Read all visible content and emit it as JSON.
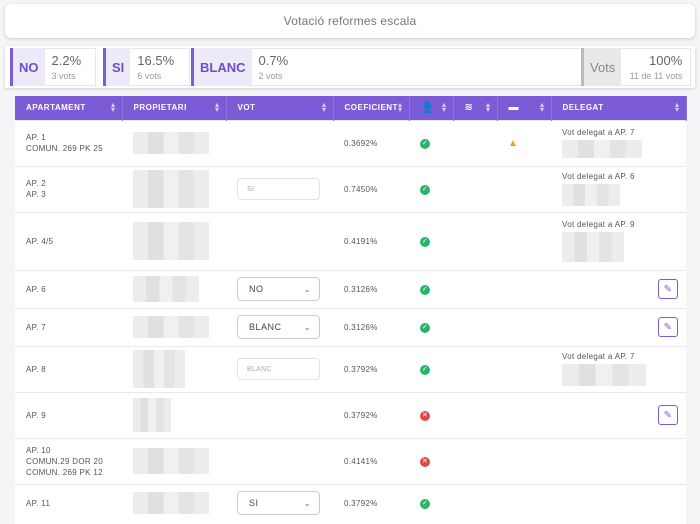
{
  "header": {
    "title": "Votació reformes escala"
  },
  "stats": [
    {
      "label": "NO",
      "pct": "2.2%",
      "count": "3 vots"
    },
    {
      "label": "SI",
      "pct": "16.5%",
      "count": "6 vots"
    },
    {
      "label": "BLANC",
      "pct": "0.7%",
      "count": "2 vots"
    },
    {
      "label": "Vots",
      "pct": "100%",
      "count": "11 de 11 vots"
    }
  ],
  "table": {
    "columns": [
      "APARTAMENT",
      "PROPIETARI",
      "VOT",
      "COEFICIENT",
      "",
      "",
      "",
      "DELEGAT"
    ],
    "rows": [
      {
        "apt": [
          "AP. 1",
          "COMUN. 269 PK 25"
        ],
        "coef": "0.3692%",
        "status": "ok",
        "warn": true,
        "delegat": "Vot delegat a AP. 7"
      },
      {
        "apt": [
          "AP. 2",
          "AP. 3"
        ],
        "vote_static": "SI",
        "coef": "0.7450%",
        "status": "ok",
        "delegat": "Vot delegat a AP. 6"
      },
      {
        "apt": [
          "AP. 4/5"
        ],
        "coef": "0.4191%",
        "status": "ok",
        "delegat": "Vot delegat a AP. 9"
      },
      {
        "apt": [
          "AP. 6"
        ],
        "vote_select": "NO",
        "coef": "0.3126%",
        "status": "ok",
        "edit": true
      },
      {
        "apt": [
          "AP. 7"
        ],
        "vote_select": "BLANC",
        "coef": "0.3126%",
        "status": "ok",
        "edit": true
      },
      {
        "apt": [
          "AP. 8"
        ],
        "vote_static": "BLANC",
        "coef": "0.3792%",
        "status": "ok",
        "delegat": "Vot delegat a AP. 7"
      },
      {
        "apt": [
          "AP. 9"
        ],
        "coef": "0.3792%",
        "status": "no",
        "edit": true
      },
      {
        "apt": [
          "AP. 10",
          "COMUN.29 DOR 20",
          "COMUN. 269 PK 12"
        ],
        "coef": "0.4141%",
        "status": "no"
      },
      {
        "apt": [
          "AP. 11"
        ],
        "vote_select": "SI",
        "coef": "0.3792%",
        "status": "ok"
      }
    ]
  },
  "colors": {
    "accent": "#7c5cd6",
    "ok": "#2bb36a",
    "error": "#e04848",
    "warning": "#f0a020"
  },
  "icons": {
    "presence": "user-check-icon",
    "online": "wifi-icon",
    "card": "card-icon",
    "edit": "edit-icon"
  }
}
